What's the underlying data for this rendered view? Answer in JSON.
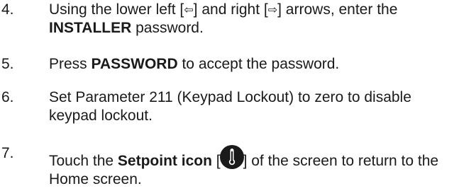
{
  "steps": [
    {
      "number": "4.",
      "part1": "Using the lower left [",
      "left_arrow": "⇦",
      "part2": "] and right [",
      "right_arrow": "⇨",
      "part3": "] arrows, enter the ",
      "bold": "INSTALLER",
      "part4": " password."
    },
    {
      "number": "5.",
      "part1": "Press ",
      "bold": "PASSWORD",
      "part2": " to accept the password."
    },
    {
      "number": "6.",
      "text": "Set Parameter 211 (Keypad Lockout) to zero to disable keypad lockout."
    },
    {
      "number": "7.",
      "part1": "Touch the ",
      "bold": "Setpoint icon",
      "part2": " [",
      "icon": "thermometer-icon",
      "part3": "] of the screen to return to the Home screen."
    }
  ]
}
